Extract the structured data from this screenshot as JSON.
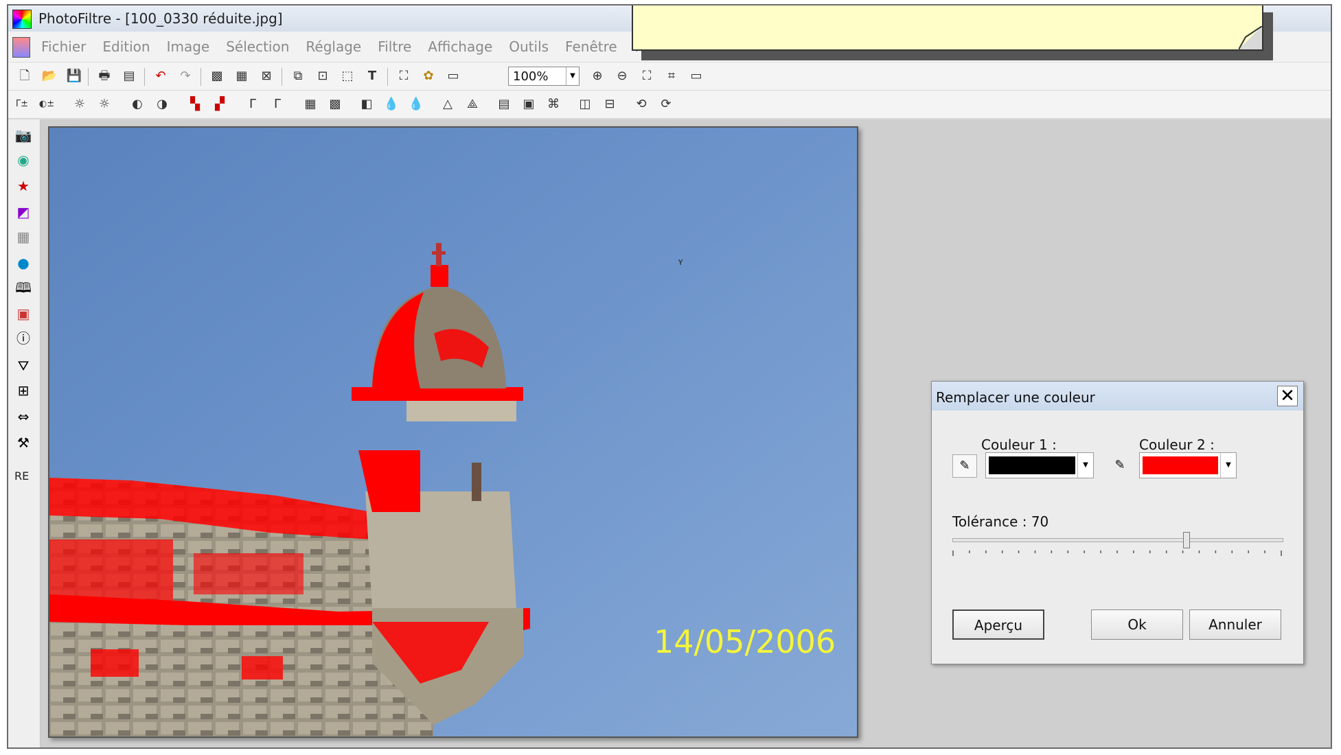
{
  "window": {
    "title": "PhotoFiltre - [100_0330 réduite.jpg]"
  },
  "menu": {
    "items": [
      "Fichier",
      "Edition",
      "Image",
      "Sélection",
      "Réglage",
      "Filtre",
      "Affichage",
      "Outils",
      "Fenêtre",
      "?"
    ]
  },
  "toolbar": {
    "zoom_value": "100%"
  },
  "left_toolbar": {
    "re_label": "RE"
  },
  "image": {
    "date_stamp": "14/05/2006"
  },
  "dialog": {
    "title": "Remplacer une couleur",
    "close_symbol": "✕",
    "color1_label": "Couleur 1 :",
    "color1_value": "#000000",
    "color2_label": "Couleur 2 :",
    "color2_value": "#ff0000",
    "tolerance_label": "Tolérance : 70",
    "tolerance_value": 70,
    "preview_button": "Aperçu",
    "ok_button": "Ok",
    "cancel_button": "Annuler"
  },
  "colors": {
    "highlight_red": "#ff0000",
    "sky_blue": "#5f88c2",
    "date_yellow": "#f5f53a"
  }
}
